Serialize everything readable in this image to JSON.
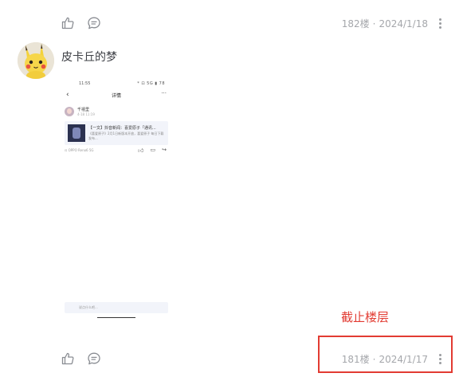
{
  "post_top": {
    "floor": "182楼",
    "date": "2024/1/18",
    "separator": "·"
  },
  "post": {
    "author": "皮卡丘的梦",
    "avatar_icon": "pikachu-avatar",
    "screenshot": {
      "status_time": "11:55",
      "status_icons": "* ⊡ 5G ▮ 78",
      "title": "详情",
      "back_icon": "‹",
      "more_icon": "···",
      "user_name": "千禧里",
      "user_sub": "4-18 11:19",
      "card_title": "【一文】抖音新闻：喜爱原子「通讯...",
      "card_desc": "《喜爱原子》2月1日新版本开放，喜爱原子 每日下载发布...",
      "source": "⊡ OPPO Reno6 5G",
      "input_placeholder": "说点什么吧..."
    }
  },
  "post_bottom": {
    "floor": "181楼",
    "date": "2024/1/17",
    "separator": "·"
  },
  "annotation": {
    "label": "截止楼层",
    "color": "#e23b32"
  },
  "icons": {
    "like": "thumbs-up-icon",
    "comment": "comment-bubble-icon",
    "more": "vertical-dots-icon"
  }
}
